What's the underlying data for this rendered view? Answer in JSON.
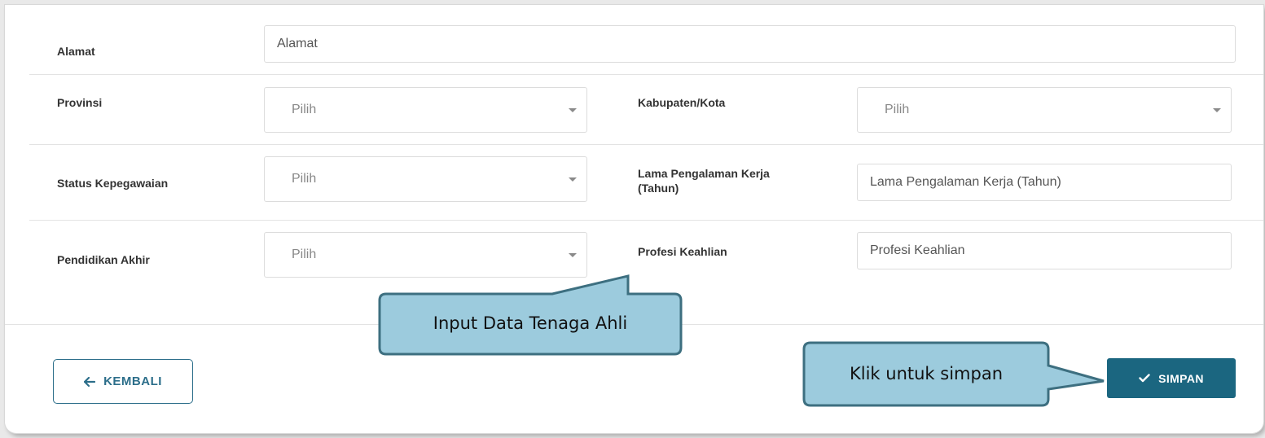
{
  "form": {
    "alamat": {
      "label": "Alamat",
      "placeholder": "Alamat"
    },
    "provinsi": {
      "label": "Provinsi",
      "value": "Pilih"
    },
    "kabupaten": {
      "label": "Kabupaten/Kota",
      "value": "Pilih"
    },
    "status": {
      "label": "Status Kepegawaian",
      "value": "Pilih"
    },
    "pengalaman": {
      "label_line1": "Lama Pengalaman Kerja",
      "label_line2": "(Tahun)",
      "placeholder": "Lama Pengalaman Kerja (Tahun)"
    },
    "pendidikan": {
      "label": "Pendidikan Akhir",
      "value": "Pilih"
    },
    "profesi": {
      "label": "Profesi Keahlian",
      "placeholder": "Profesi Keahlian"
    }
  },
  "buttons": {
    "back": {
      "label": "KEMBALI",
      "icon": "arrow-left-icon"
    },
    "save": {
      "label": "SIMPAN",
      "icon": "check-icon"
    }
  },
  "callouts": {
    "input_data": "Input Data Tenaga Ahli",
    "save_hint": "Klik untuk simpan"
  },
  "colors": {
    "primary": "#1b6680",
    "callout_fill": "#9ccbdd",
    "callout_border": "#3d6f80"
  }
}
